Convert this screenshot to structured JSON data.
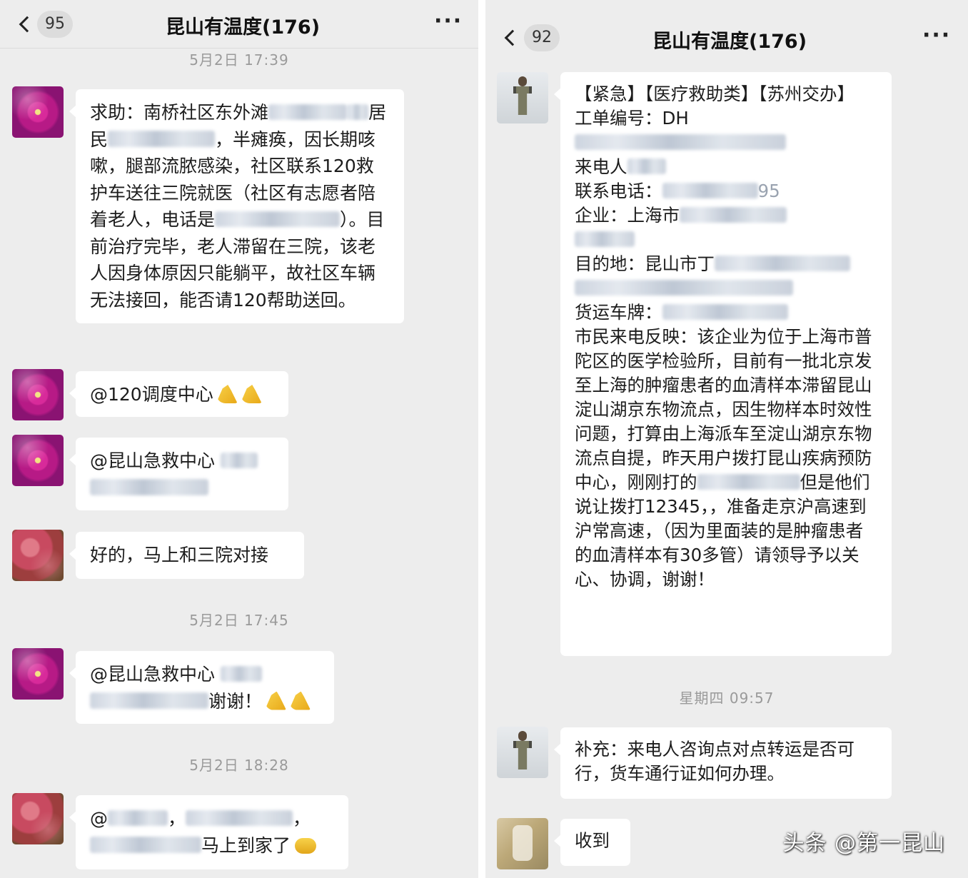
{
  "left": {
    "header": {
      "badge": "95",
      "title": "昆山有温度(176)",
      "more": "···"
    },
    "timestamps": [
      "5月2日 17:39",
      "5月2日 17:45",
      "5月2日 18:28"
    ],
    "messages": [
      {
        "segments": [
          "求助：南桥社区东外滩",
          "",
          "居民",
          "",
          "，半瘫痪，因长期咳嗽，腿部流脓感染，社区联系120救护车送往三院就医（社区有志愿者陪着老人，电话是",
          "",
          "）。目前治疗完毕，老人滞留在三院，该老人因身体原因只能躺平，故社区车辆无法接回，能否请120帮助送回。"
        ]
      },
      {
        "segments": [
          "@120调度中心"
        ]
      },
      {
        "segments": [
          "@昆山急救中心 ",
          ""
        ]
      },
      {
        "segments": [
          "好的，马上和三院对接"
        ]
      },
      {
        "segments": [
          "@昆山急救中心 ",
          "",
          "谢谢！"
        ]
      },
      {
        "segments": [
          "@",
          "，",
          "，",
          "马上到家了"
        ]
      }
    ]
  },
  "right": {
    "header": {
      "badge": "92",
      "title": "昆山有温度(176)",
      "more": "···"
    },
    "timestamps": [
      "星期四 09:57"
    ],
    "messages": [
      {
        "lines": [
          "【紧急】【医疗救助类】【苏州交办】",
          "工单编号：DH",
          "",
          "来电人",
          "联系电话：",
          "企业：上海市",
          "",
          "目的地：昆山市丁",
          "",
          "货运车牌：",
          "市民来电反映：该企业为位于上海市普陀区的医学检验所，目前有一批北京发至上海的肿瘤患者的血清样本滞留昆山淀山湖京东物流点，因生物样本时效性问题，打算由上海派车至淀山湖京东物流点自提，昨天用户拨打昆山疾病预防中心，刚刚打的",
          "但是他们说让拨打12345，，准备走京沪高速到沪常高速，（因为里面装的是肿瘤患者的血清样本有30多管）请领导予以关心、协调，谢谢！"
        ],
        "phone_tail": "95"
      },
      {
        "lines": [
          "补充：来电人咨询点对点转运是否可行，货车通行证如何办理。"
        ]
      },
      {
        "lines": [
          "收到"
        ]
      }
    ]
  },
  "watermark": "头条 @第一昆山",
  "colors": {
    "chat_bg": "#ededed",
    "bubble": "#ffffff",
    "timestamp": "#9a9a9a"
  }
}
